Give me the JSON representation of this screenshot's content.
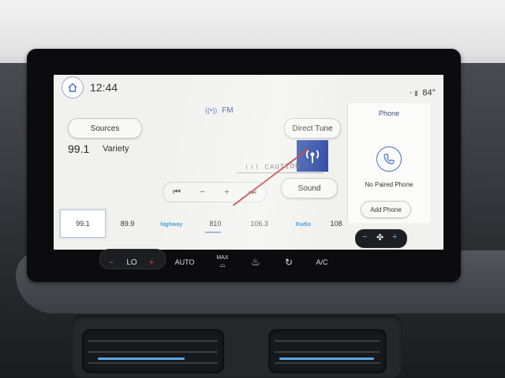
{
  "status_bar": {
    "time": "12:44",
    "temperature": "84°"
  },
  "radio": {
    "band": "FM",
    "sources_label": "Sources",
    "direct_tune_label": "Direct Tune",
    "sound_label": "Sound",
    "station_freq": "99.1",
    "station_name": "Variety",
    "caution_text": "!!! CAUTION !!!",
    "seek_back_glyph": "⏮",
    "minus_glyph": "−",
    "plus_glyph": "+",
    "seek_fwd_glyph": "⏭"
  },
  "phone": {
    "title": "Phone",
    "status": "No Paired Phone",
    "add_label": "Add Phone"
  },
  "presets": [
    {
      "label": "99.1"
    },
    {
      "label": "89.9"
    },
    {
      "label": "highway"
    },
    {
      "label": "810"
    },
    {
      "label": "106.3"
    },
    {
      "label": "Radio"
    },
    {
      "label": "108"
    }
  ],
  "climate": {
    "lo_label": "LO",
    "auto_label": "AUTO",
    "max_label": "MAX",
    "ac_label": "A/C",
    "minus_glyph": "−",
    "plus_glyph": "+"
  },
  "colors": {
    "accent": "#3b4f88",
    "active_border": "#b9c5d8",
    "art_bg": "#2f4da6",
    "heat_red": "#d23a3a"
  }
}
